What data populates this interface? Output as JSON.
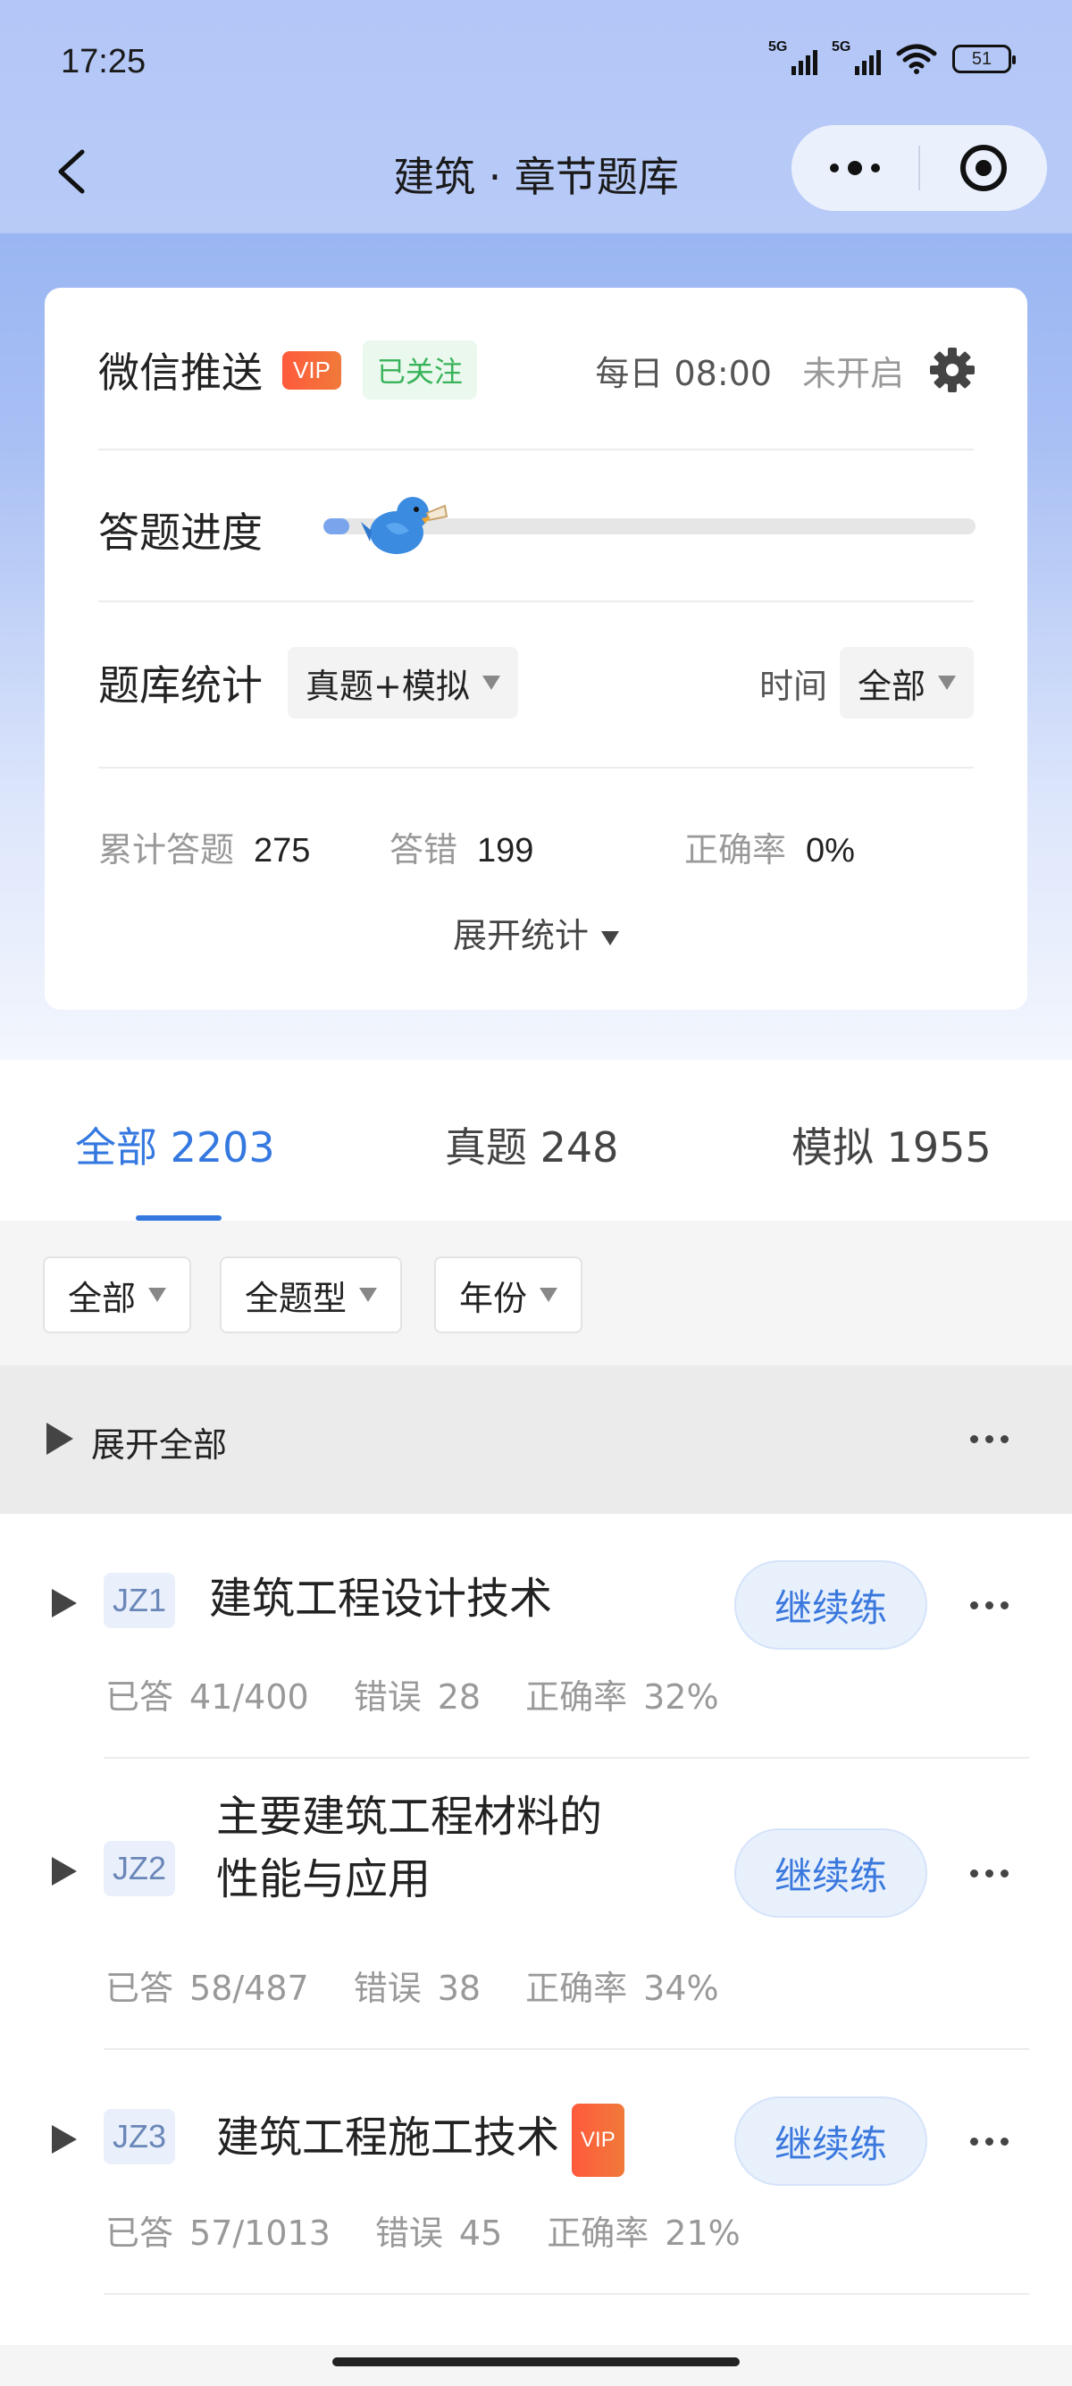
{
  "status_bar": {
    "time": "17:25",
    "net1": "5G",
    "net2": "5G",
    "battery": "51"
  },
  "nav": {
    "title": "建筑 · 章节题库"
  },
  "card": {
    "push_label": "微信推送",
    "vip": "VIP",
    "followed": "已关注",
    "push_time": "每日 08:00",
    "push_status": "未开启",
    "progress_label": "答题进度",
    "progress_fraction": 0.04,
    "stats_label": "题库统计",
    "stats_filter": "真题+模拟",
    "time_label": "时间",
    "time_filter": "全部",
    "metrics": [
      {
        "label": "累计答题",
        "value": "275"
      },
      {
        "label": "答错",
        "value": "199"
      },
      {
        "label": "正确率",
        "value": "0%"
      }
    ],
    "expand_stats": "展开统计"
  },
  "tabs": [
    {
      "label": "全部 2203",
      "active": true
    },
    {
      "label": "真题 248",
      "active": false
    },
    {
      "label": "模拟 1955",
      "active": false
    }
  ],
  "filters": [
    "全部",
    "全题型",
    "年份"
  ],
  "expand_all": "展开全部",
  "chapters": [
    {
      "code": "JZ1",
      "title_lines": [
        "建筑工程设计技术"
      ],
      "vip": false,
      "action": "继续练",
      "answered_label": "已答",
      "answered": "41/400",
      "errors_label": "错误",
      "errors": "28",
      "accuracy_label": "正确率",
      "accuracy": "32%"
    },
    {
      "code": "JZ2",
      "title_lines": [
        "主要建筑工程材料的",
        "性能与应用"
      ],
      "vip": false,
      "action": "继续练",
      "answered_label": "已答",
      "answered": "58/487",
      "errors_label": "错误",
      "errors": "38",
      "accuracy_label": "正确率",
      "accuracy": "34%"
    },
    {
      "code": "JZ3",
      "title_lines": [
        "建筑工程施工技术"
      ],
      "vip": true,
      "vip_label": "VIP",
      "action": "继续练",
      "answered_label": "已答",
      "answered": "57/1013",
      "errors_label": "错误",
      "errors": "45",
      "accuracy_label": "正确率",
      "accuracy": "21%"
    }
  ],
  "colors": {
    "accent": "#3478e0",
    "vip": "#f05a3c",
    "followed": "#39b35a"
  }
}
